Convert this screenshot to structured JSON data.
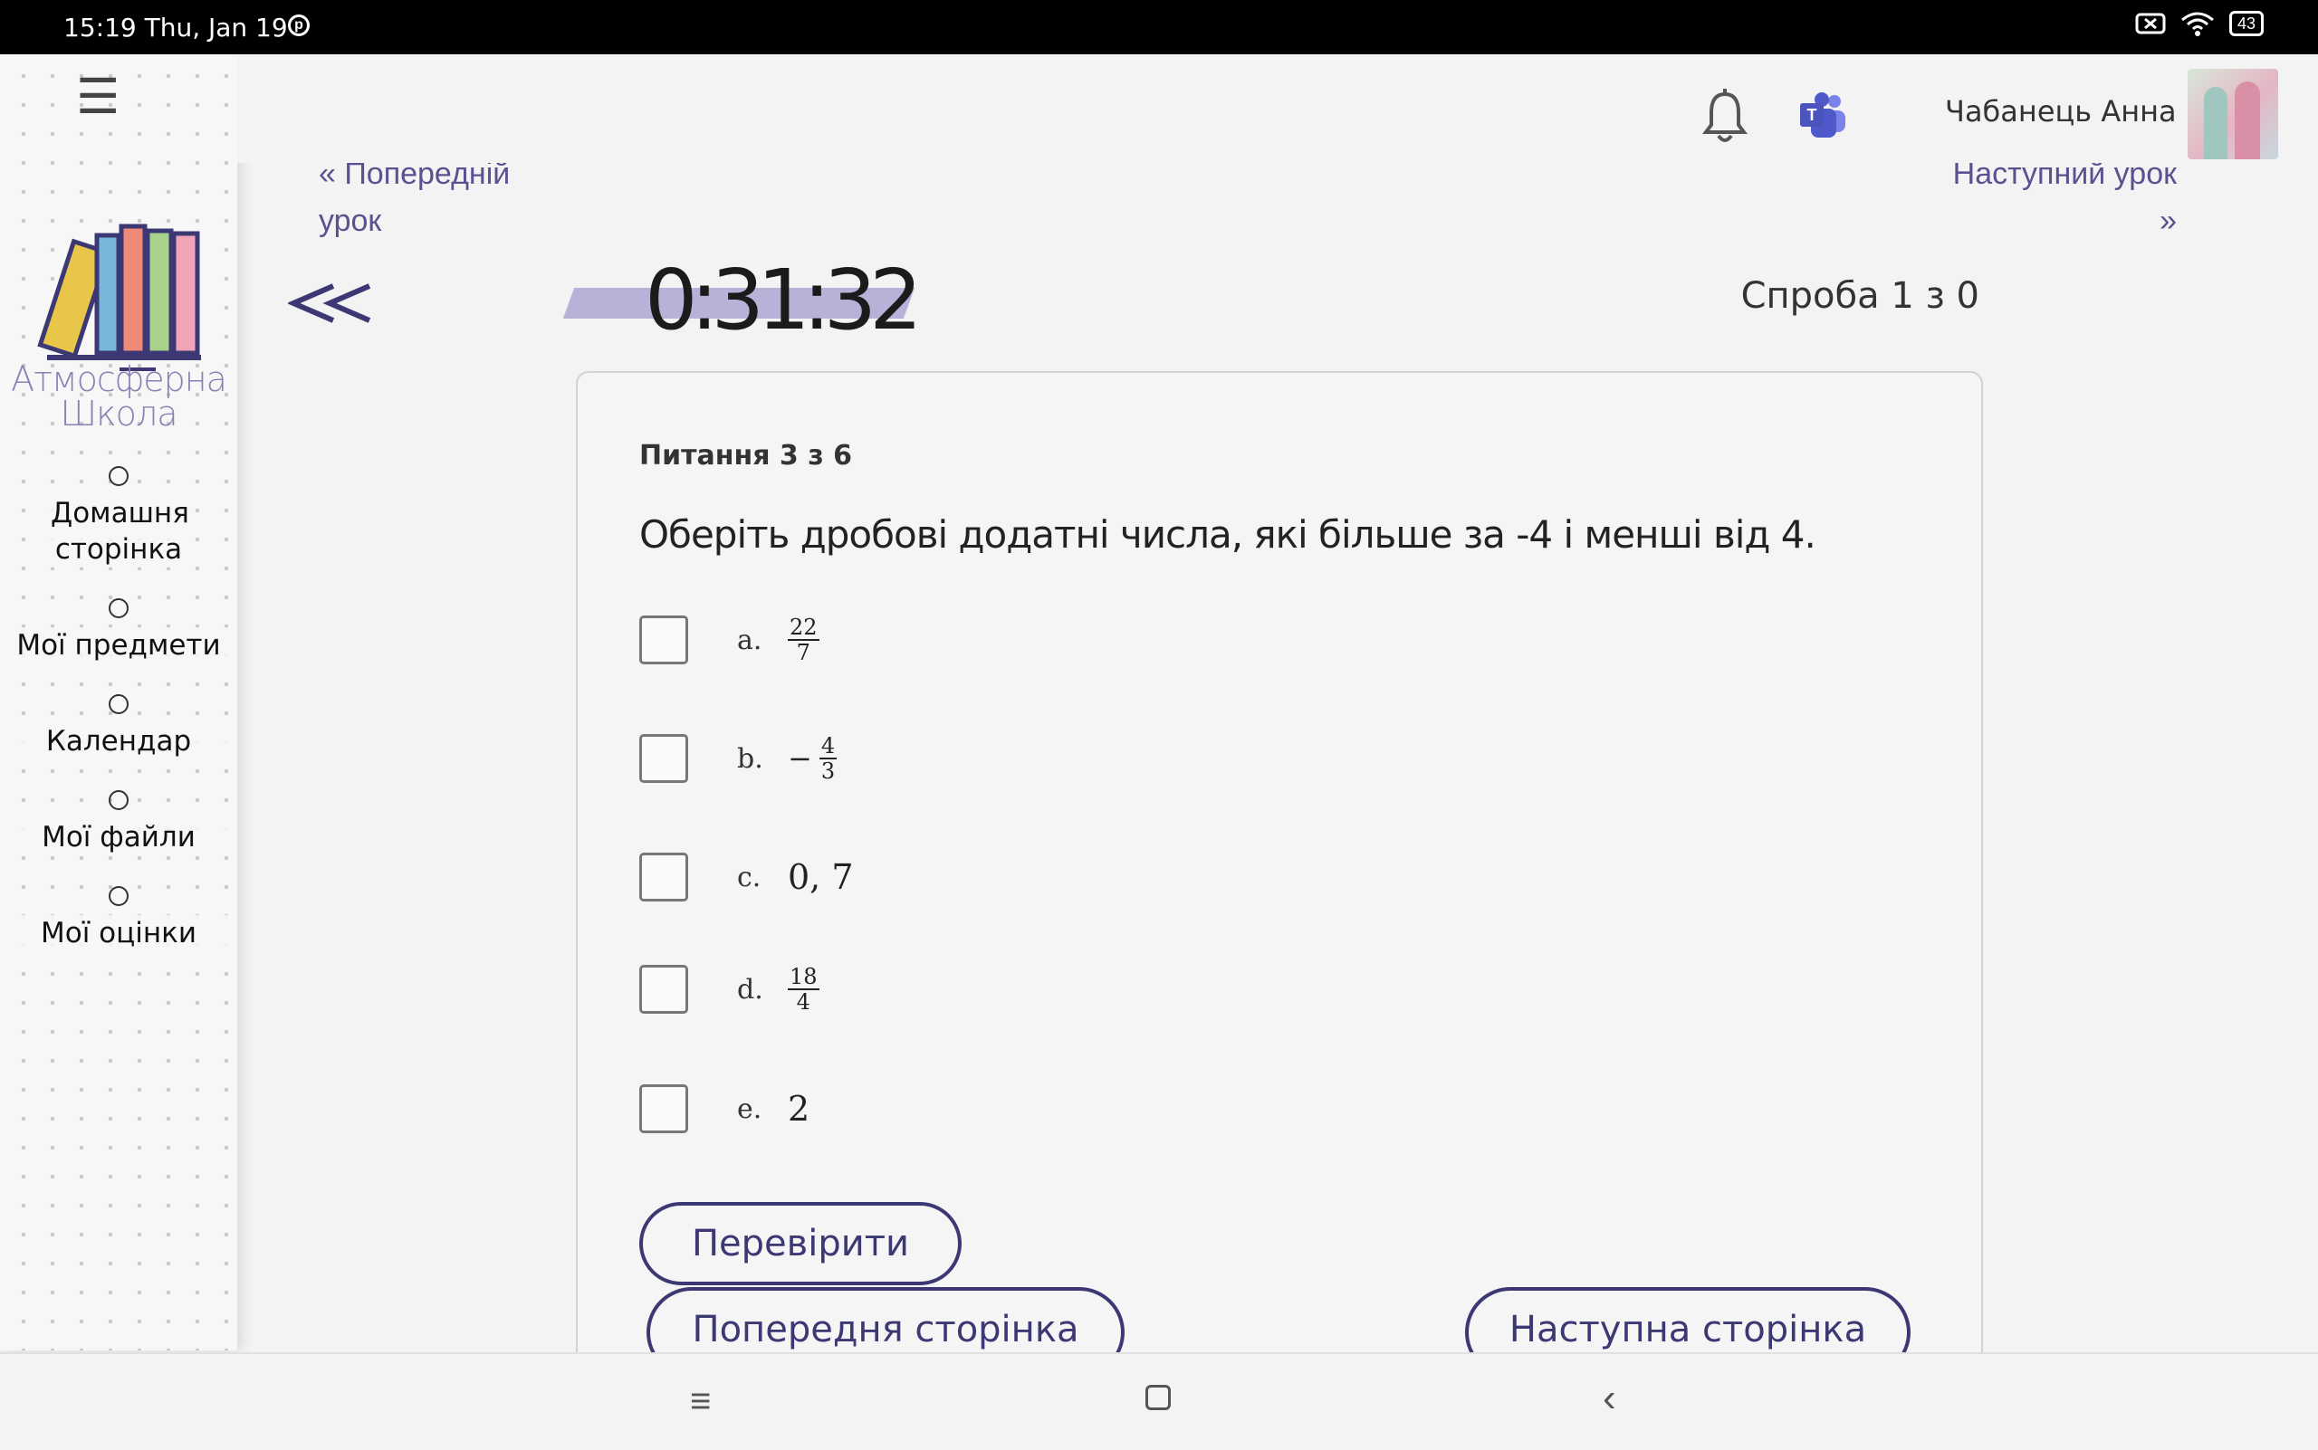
{
  "status_bar": {
    "time": "15:19  Thu, Jan 19",
    "battery": "43"
  },
  "sidebar": {
    "logo_text_line1": "Атмосферна",
    "logo_text_line2": "Школа",
    "items": [
      {
        "label": "Домашня сторінка"
      },
      {
        "label": "Мої предмети"
      },
      {
        "label": "Календар"
      },
      {
        "label": "Мої файли"
      },
      {
        "label": "Мої оцінки"
      }
    ]
  },
  "header": {
    "user_name": "Чабанець Анна",
    "icons": [
      "bell-icon",
      "teams-icon"
    ]
  },
  "lesson_nav": {
    "prev_line1": "« Попередній",
    "prev_line2": "урок",
    "next_line1": "Наступний урок",
    "next_line2": "»"
  },
  "quiz": {
    "timer": "0:31:32",
    "attempt": "Спроба 1 з 0",
    "question_number": "Питання 3 з 6",
    "question_text": "Оберіть дробові додатні числа, які більше за -4 і менші від 4.",
    "options": [
      {
        "letter": "a.",
        "num": "22",
        "den": "7"
      },
      {
        "letter": "b.",
        "sign": "−",
        "num": "4",
        "den": "3"
      },
      {
        "letter": "c.",
        "value": "0, 7"
      },
      {
        "letter": "d.",
        "num": "18",
        "den": "4"
      },
      {
        "letter": "e.",
        "value": "2"
      }
    ],
    "check_button": "Перевірити",
    "prev_page_button": "Попередня сторінка",
    "next_page_button": "Наступна сторінка"
  },
  "colors": {
    "accent": "#3c3873",
    "link": "#5a5290",
    "timer_band": "#b8b2d8"
  }
}
